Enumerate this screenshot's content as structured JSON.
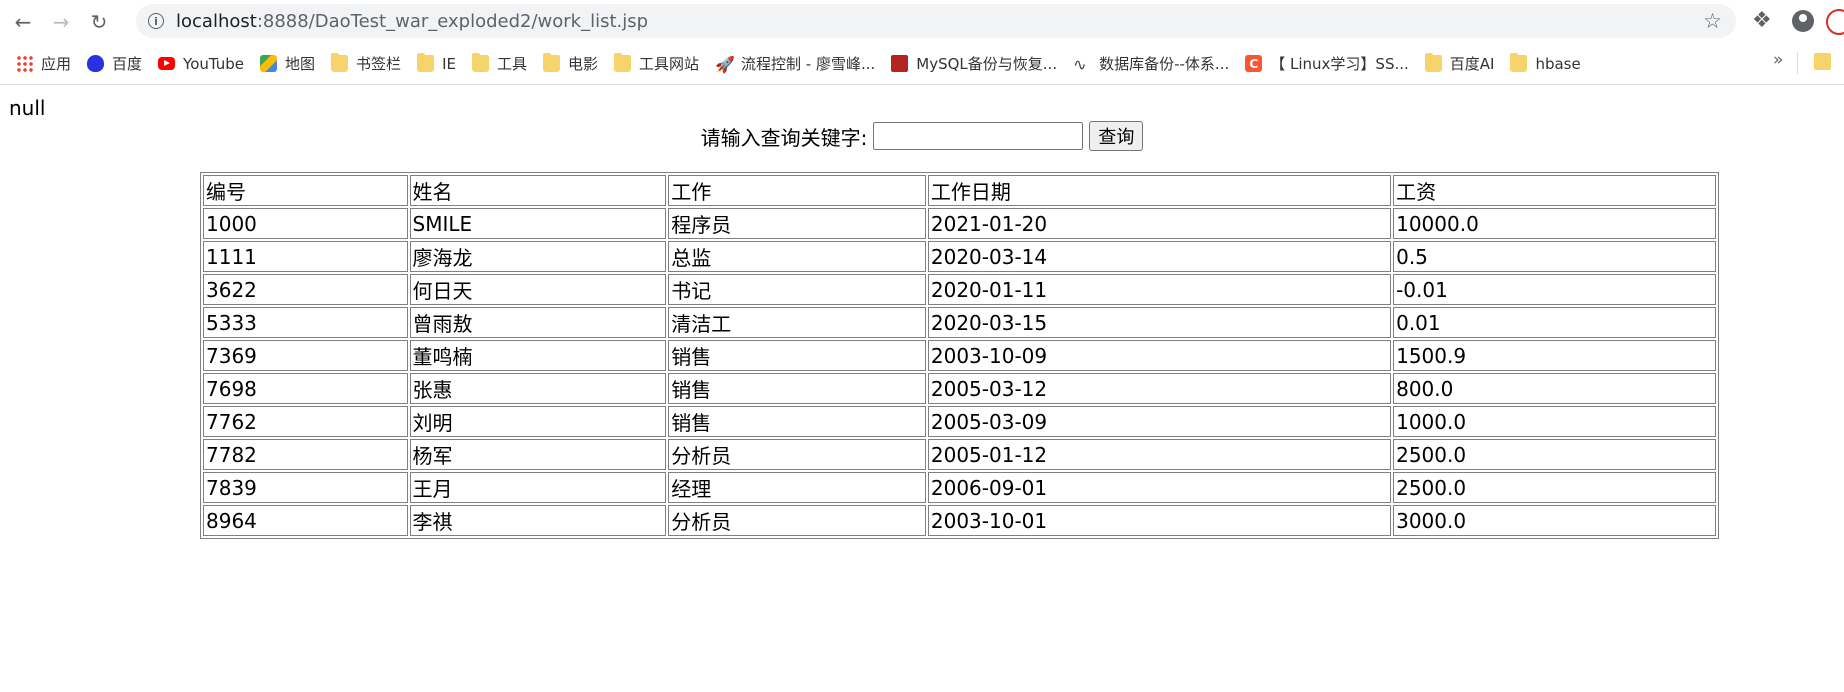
{
  "browser": {
    "url_host": "localhost",
    "url_path": ":8888/DaoTest_war_exploded2/work_list.jsp",
    "bookmarks": [
      {
        "label": "应用",
        "icon": "apps-icon"
      },
      {
        "label": "百度",
        "icon": "baidu-icon"
      },
      {
        "label": "YouTube",
        "icon": "youtube-icon"
      },
      {
        "label": "地图",
        "icon": "maps-icon"
      },
      {
        "label": "书签栏",
        "icon": "folder-icon"
      },
      {
        "label": "IE",
        "icon": "folder-icon"
      },
      {
        "label": "工具",
        "icon": "folder-icon"
      },
      {
        "label": "电影",
        "icon": "folder-icon"
      },
      {
        "label": "工具网站",
        "icon": "folder-icon"
      },
      {
        "label": "流程控制 - 廖雪峰...",
        "icon": "rocket-icon"
      },
      {
        "label": "MySQL备份与恢复...",
        "icon": "mysql-icon"
      },
      {
        "label": "数据库备份--体系...",
        "icon": "wave-icon"
      },
      {
        "label": "【 Linux学习】SS...",
        "icon": "csdn-icon"
      },
      {
        "label": "百度AI",
        "icon": "folder-icon"
      },
      {
        "label": "hbase",
        "icon": "folder-icon"
      }
    ],
    "more_label": "»"
  },
  "page": {
    "null_text": "null",
    "search_label": "请输入查询关键字:",
    "search_value": "",
    "search_button": "查询"
  },
  "table": {
    "headers": [
      "编号",
      "姓名",
      "工作",
      "工作日期",
      "工资"
    ],
    "rows": [
      [
        "1000",
        "SMILE",
        "程序员",
        "2021-01-20",
        "10000.0"
      ],
      [
        "1111",
        "廖海龙",
        "总监",
        "2020-03-14",
        "0.5"
      ],
      [
        "3622",
        "何日天",
        "书记",
        "2020-01-11",
        "-0.01"
      ],
      [
        "5333",
        "曾雨敖",
        "清洁工",
        "2020-03-15",
        "0.01"
      ],
      [
        "7369",
        "董鸣楠",
        "销售",
        "2003-10-09",
        "1500.9"
      ],
      [
        "7698",
        "张惠",
        "销售",
        "2005-03-12",
        "800.0"
      ],
      [
        "7762",
        "刘明",
        "销售",
        "2005-03-09",
        "1000.0"
      ],
      [
        "7782",
        "杨军",
        "分析员",
        "2005-01-12",
        "2500.0"
      ],
      [
        "7839",
        "王月",
        "经理",
        "2006-09-01",
        "2500.0"
      ],
      [
        "8964",
        "李祺",
        "分析员",
        "2003-10-01",
        "3000.0"
      ]
    ]
  }
}
